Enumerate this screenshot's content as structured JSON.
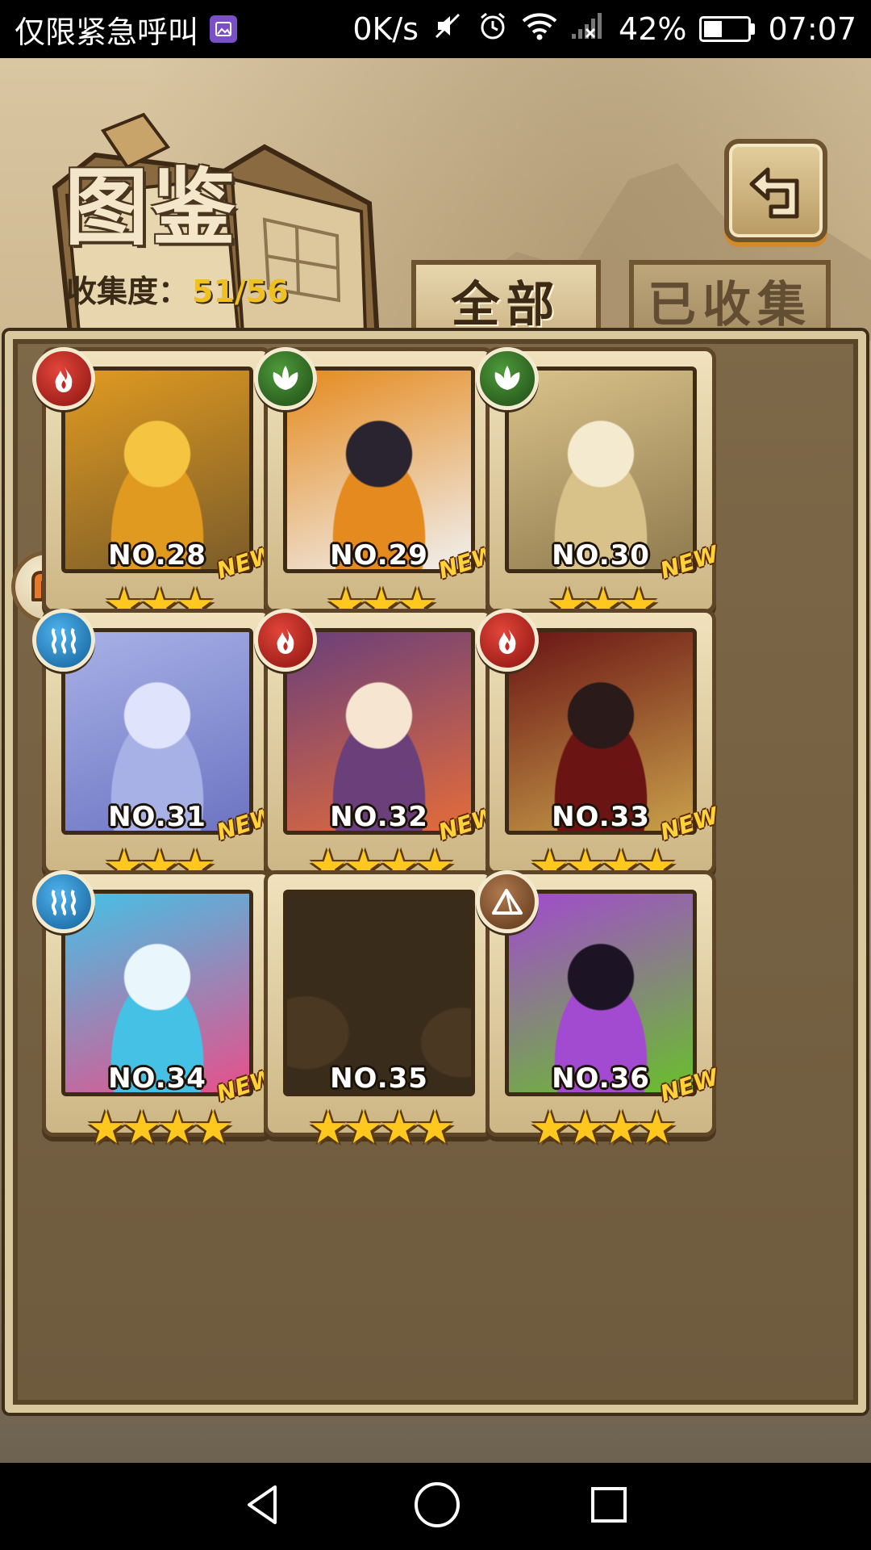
{
  "status_bar": {
    "carrier_text": "仅限紧急呼叫",
    "speed": "0K/s",
    "battery_percent": "42%",
    "battery_level": 0.42,
    "time": "07:07"
  },
  "header": {
    "title": "图鉴",
    "collection_label": "收集度：",
    "collection_value": "51/56"
  },
  "tabs": [
    {
      "label": "全部",
      "active": true
    },
    {
      "label": "已收集",
      "active": false
    }
  ],
  "cards": [
    {
      "number": "NO.28",
      "element": "fire-icon",
      "badge": "NEW",
      "stars": "★★★",
      "star_count": 3,
      "palette": [
        "#f5c542",
        "#e09a20",
        "#7a5c2a"
      ]
    },
    {
      "number": "NO.29",
      "element": "leaf-icon",
      "badge": "NEW",
      "stars": "★★★",
      "star_count": 3,
      "palette": [
        "#2a2430",
        "#e58a1e",
        "#f0f0f0"
      ]
    },
    {
      "number": "NO.30",
      "element": "leaf-icon",
      "badge": "NEW",
      "stars": "★★★",
      "star_count": 3,
      "palette": [
        "#f3ead0",
        "#d9c28a",
        "#8f7a4e"
      ]
    },
    {
      "number": "NO.31",
      "element": "water-icon",
      "badge": "NEW",
      "stars": "★★★",
      "star_count": 3,
      "palette": [
        "#dfe3fb",
        "#a8b1e6",
        "#6c74c2"
      ]
    },
    {
      "number": "NO.32",
      "element": "fire-icon",
      "badge": "NEW",
      "stars": "★★★★",
      "star_count": 4,
      "palette": [
        "#f6e5d0",
        "#6a3f7a",
        "#e46c3a"
      ]
    },
    {
      "number": "NO.33",
      "element": "fire-icon",
      "badge": "NEW",
      "stars": "★★★★",
      "star_count": 4,
      "palette": [
        "#2a1a1a",
        "#6a1414",
        "#c9a04a"
      ]
    },
    {
      "number": "NO.34",
      "element": "water-icon",
      "badge": "NEW",
      "stars": "★★★★",
      "star_count": 4,
      "palette": [
        "#e9f6fb",
        "#45c1e6",
        "#e84f8a"
      ]
    },
    {
      "number": "NO.35",
      "element": "",
      "badge": "",
      "stars": "★★★★",
      "star_count": 4,
      "palette": [
        "#4a3822",
        "#3a2c1a",
        "#2e2314"
      ]
    },
    {
      "number": "NO.36",
      "element": "mountain-icon",
      "badge": "NEW",
      "stars": "★★★★",
      "star_count": 4,
      "palette": [
        "#1c1424",
        "#a24ad0",
        "#68c02a"
      ]
    }
  ],
  "colors": {
    "fire": "#c4281f",
    "wood": "#2e6b22",
    "water": "#1b88c8",
    "earth": "#8a5a32",
    "star": "#ffc81e",
    "collection_value": "#f0c020"
  }
}
